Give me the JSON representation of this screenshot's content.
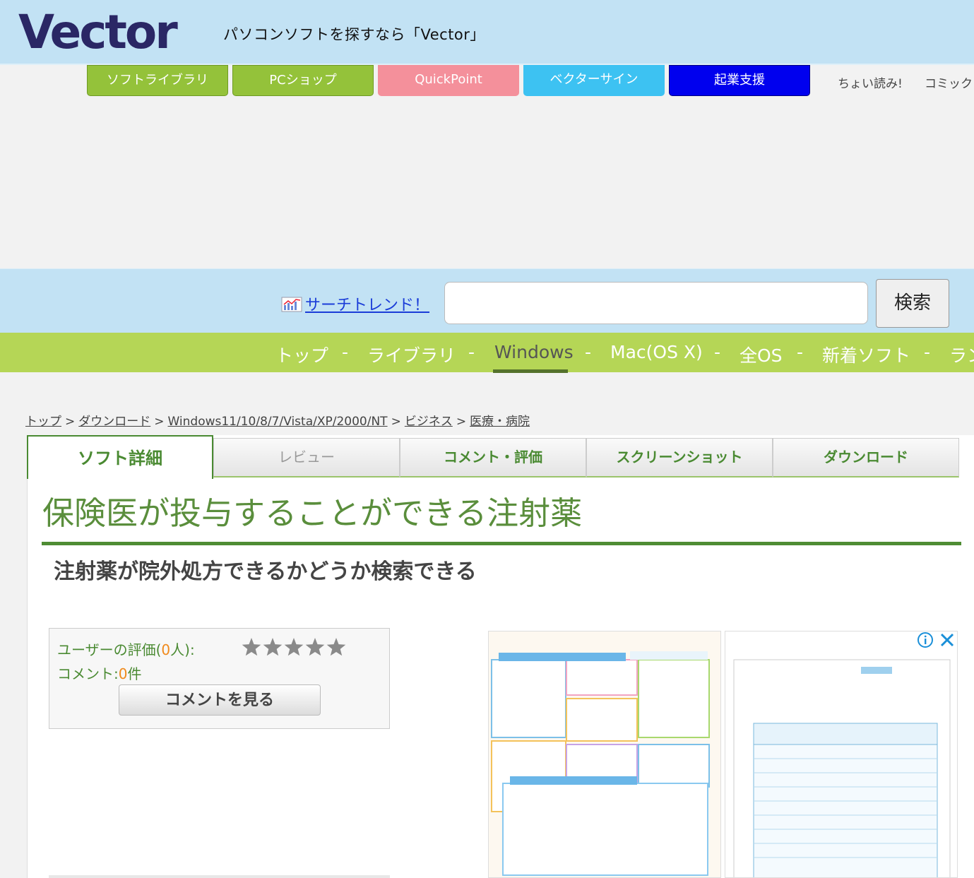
{
  "header": {
    "logo_text": "Vector",
    "tagline": "パソコンソフトを探すなら「Vector」"
  },
  "services": [
    {
      "label": "ソフトライブラリ",
      "color": "#94c23a"
    },
    {
      "label": "PCショップ",
      "color": "#94c23a"
    },
    {
      "label": "QuickPoint",
      "color": "#f4909b"
    },
    {
      "label": "ベクターサイン",
      "color": "#3dc2f2"
    },
    {
      "label": "起業支援",
      "color": "#0000ee"
    }
  ],
  "service_links": [
    "ちょい読み!",
    "コミック"
  ],
  "search": {
    "trend_label": "サーチトレンド！",
    "input_value": "",
    "button_label": "検索"
  },
  "os_nav": {
    "items": [
      "トップ",
      "ライブラリ",
      "Windows",
      "Mac(OS X)",
      "全OS",
      "新着ソフト",
      "ラン"
    ],
    "separator": "-",
    "active": "Windows"
  },
  "breadcrumb": {
    "items": [
      "トップ",
      "ダウンロード",
      "Windows11/10/8/7/Vista/XP/2000/NT",
      "ビジネス",
      "医療・病院"
    ],
    "separator": ">"
  },
  "tabs": {
    "active": "ソフト詳細",
    "items": [
      "レビュー",
      "コメント・評価",
      "スクリーンショット",
      "ダウンロード"
    ]
  },
  "software": {
    "title": "保険医が投与することができる注射薬",
    "subtitle": "注射薬が院外処方できるかどうか検索できる"
  },
  "rating": {
    "label_prefix": "ユーザーの評価(",
    "count": "0",
    "label_suffix": "人):",
    "stars_filled": 0,
    "stars_total": 5,
    "comment_prefix": "コメント:",
    "comment_count": "0",
    "comment_suffix": "件",
    "button_label": "コメントを見る"
  },
  "colors": {
    "header_bg": "#c2e2f4",
    "os_nav_bg": "#b5d656",
    "accent_green": "#4e8c33",
    "count_orange": "#f08a1c"
  }
}
